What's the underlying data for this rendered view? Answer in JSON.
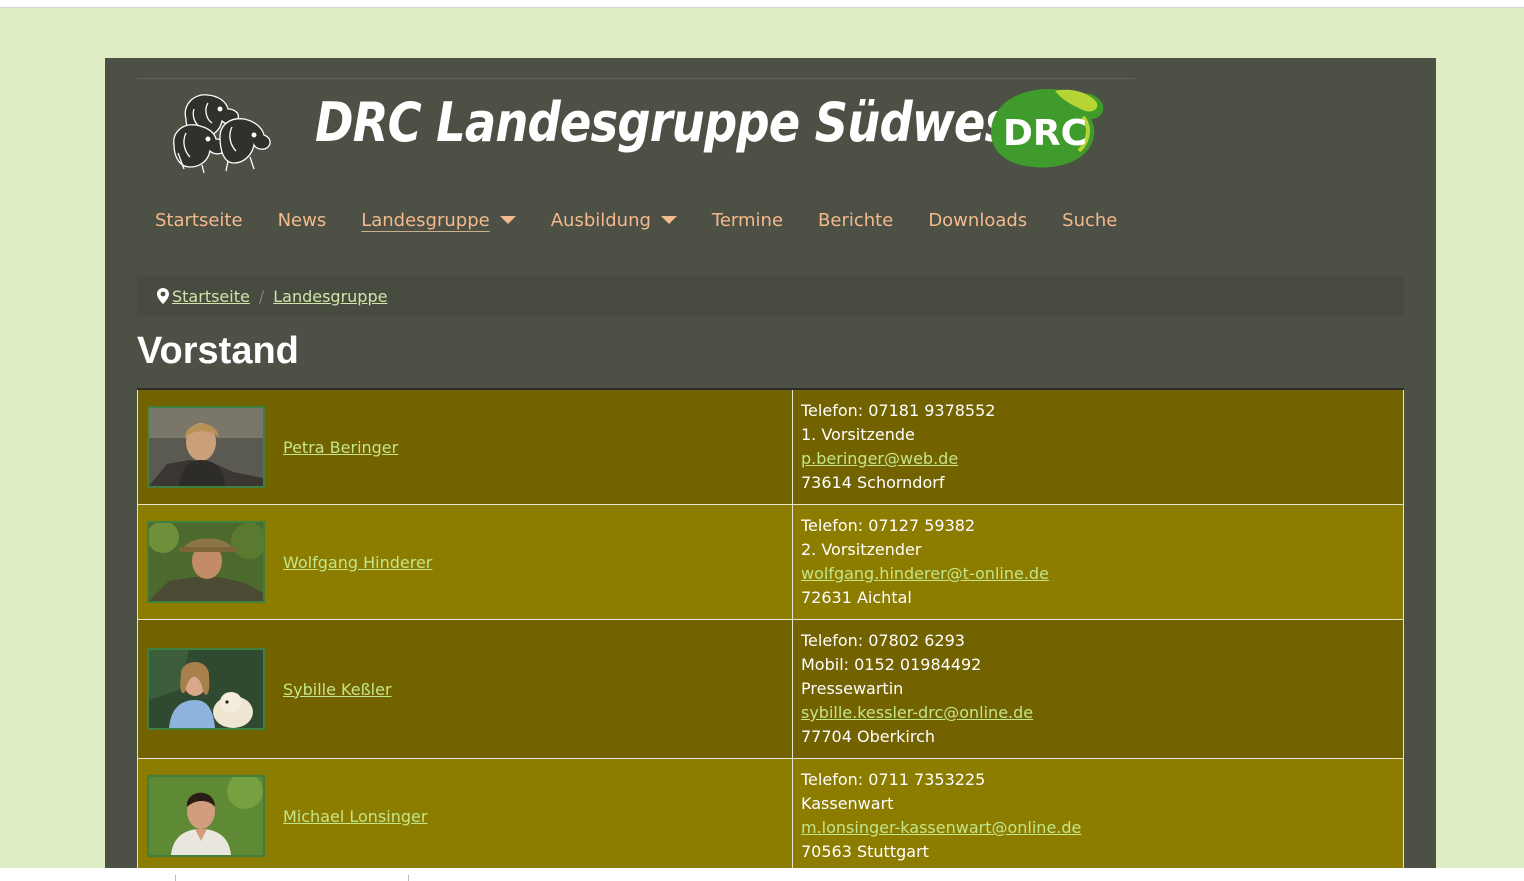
{
  "header": {
    "site_title": "DRC Landesgruppe Südwest",
    "logo_text": "DRC",
    "logo_color": "#3f9b2b",
    "logo_accent": "#b6d534"
  },
  "nav": [
    {
      "label": "Startseite",
      "has_dropdown": false
    },
    {
      "label": "News",
      "has_dropdown": false
    },
    {
      "label": "Landesgruppe",
      "has_dropdown": true,
      "active": true
    },
    {
      "label": "Ausbildung",
      "has_dropdown": true
    },
    {
      "label": "Termine",
      "has_dropdown": false
    },
    {
      "label": "Berichte",
      "has_dropdown": false
    },
    {
      "label": "Downloads",
      "has_dropdown": false
    },
    {
      "label": "Suche",
      "has_dropdown": false
    }
  ],
  "breadcrumb": {
    "icon": "map-pin-icon",
    "items": [
      "Startseite",
      "Landesgruppe"
    ],
    "separator": "/"
  },
  "page_title": "Vorstand",
  "members": [
    {
      "name": "Petra Beringer",
      "lines": [
        "Telefon: 07181 9378552",
        "1. Vorsitzende"
      ],
      "email": "p.beringer@web.de",
      "city": "73614 Schorndorf"
    },
    {
      "name": "Wolfgang Hinderer",
      "lines": [
        "Telefon: 07127 59382",
        "2. Vorsitzender"
      ],
      "email": "wolfgang.hinderer@t-online.de",
      "city": "72631 Aichtal"
    },
    {
      "name": "Sybille Keßler",
      "lines": [
        "Telefon: 07802 6293",
        "Mobil: 0152 01984492",
        "Pressewartin"
      ],
      "email": "sybille.kessler-drc@online.de",
      "city": "77704 Oberkirch"
    },
    {
      "name": "Michael Lonsinger",
      "lines": [
        "Telefon: 0711 7353225",
        "Kassenwart"
      ],
      "email": "m.lonsinger-kassenwart@online.de",
      "city": "70563 Stuttgart"
    }
  ],
  "colors": {
    "page_bg": "#dfedc5",
    "content_bg": "#4c5045",
    "nav_text": "#f4b98c",
    "row_dark": "#736300",
    "row_light": "#8c7c00",
    "link": "#c4e58a"
  }
}
